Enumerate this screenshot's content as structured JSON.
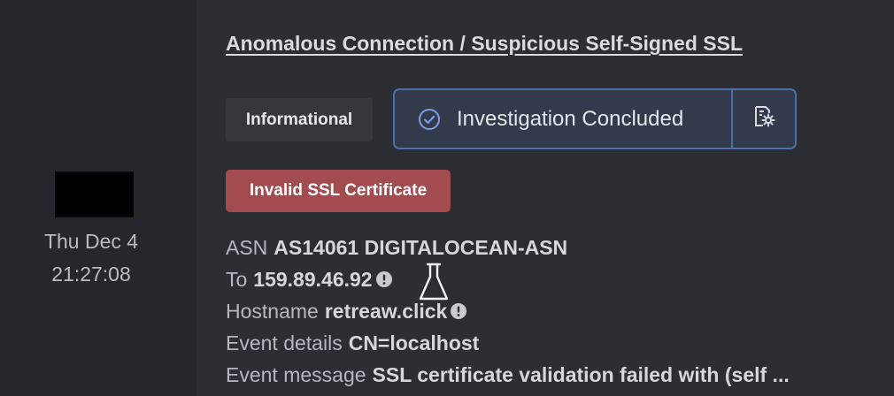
{
  "timeline": {
    "date": "Thu Dec 4",
    "time": "21:27:08"
  },
  "alert": {
    "title": "Anomalous Connection / Suspicious Self-Signed SSL",
    "severity": "Informational",
    "status": "Investigation Concluded",
    "tag": "Invalid SSL Certificate"
  },
  "details": {
    "asn_label": "ASN",
    "asn_value": "AS14061 DIGITALOCEAN-ASN",
    "to_label": "To",
    "to_value": "159.89.46.92",
    "hostname_label": "Hostname",
    "hostname_value": "retreaw.click",
    "event_details_label": "Event details",
    "event_details_value": "CN=localhost",
    "event_message_label": "Event message",
    "event_message_value": "SSL certificate validation failed with (self ..."
  },
  "icons": {
    "status": "check-circle-icon",
    "status_action": "gear-document-icon",
    "info": "info-icon",
    "flask": "flask-icon"
  },
  "colors": {
    "background": "#2c2e34",
    "sidebar": "#25272c",
    "status_border": "#4c6fa6",
    "status_fill": "#323a4c",
    "tag_red": "#a34c4f",
    "severity_fill": "#35373d"
  }
}
